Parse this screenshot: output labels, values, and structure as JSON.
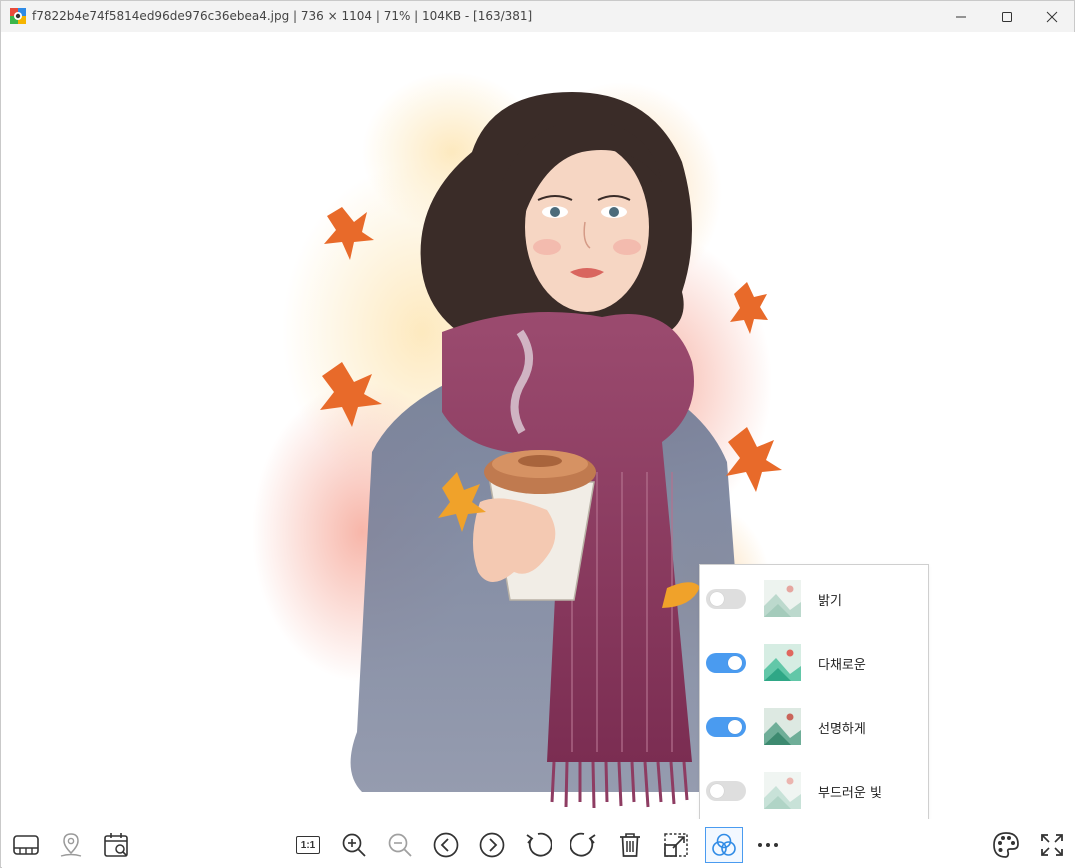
{
  "window": {
    "title": "f7822b4e74f5814ed96de976c36ebea4.jpg  |  736 × 1104  |  71%  |  104KB  -  [163/381]"
  },
  "titlebar": {
    "minimize_icon": "minimize-icon",
    "maximize_icon": "maximize-icon",
    "close_icon": "close-icon"
  },
  "filters": {
    "items": [
      {
        "label": "밝기",
        "enabled": false
      },
      {
        "label": "다채로운",
        "enabled": true
      },
      {
        "label": "선명하게",
        "enabled": true
      },
      {
        "label": "부드러운 빛",
        "enabled": false
      }
    ]
  },
  "toolbar": {
    "actual_size_label": "1:1",
    "left_icons": [
      "filmstrip-icon",
      "location-pin-icon",
      "calendar-search-icon"
    ],
    "center_icons": [
      "actual-size-icon",
      "zoom-in-icon",
      "zoom-out-icon",
      "previous-icon",
      "next-icon",
      "rotate-left-icon",
      "rotate-right-icon",
      "delete-icon",
      "crop-resize-icon",
      "filters-icon",
      "more-icon"
    ],
    "right_icons": [
      "palette-icon",
      "fullscreen-icon"
    ]
  },
  "colors": {
    "accent": "#4a9bf0",
    "toggle_off": "#dedede",
    "titlebar_bg": "#f3f3f3"
  }
}
